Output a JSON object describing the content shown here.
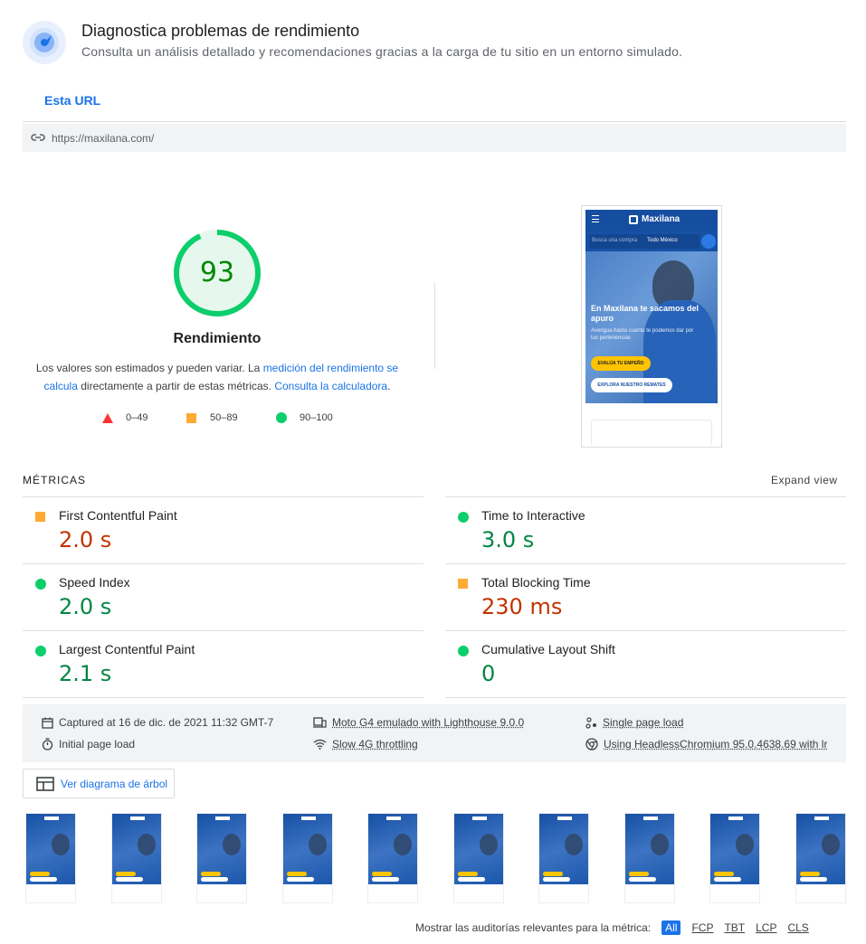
{
  "header": {
    "icon": "pagespeed-gauge-icon",
    "title": "Diagnostica problemas de rendimiento",
    "subtitle": "Consulta un análisis detallado y recomendaciones gracias a la carga de tu sitio en un entorno simulado."
  },
  "tabs": [
    {
      "label": "Esta URL",
      "active": true
    }
  ],
  "url_bar": {
    "icon": "link-icon",
    "url": "https://maxilana.com/"
  },
  "score": {
    "value": "93",
    "fraction": 0.93,
    "label": "Rendimiento",
    "color": "#0cce6b",
    "desc_prefix": "Los valores son estimados y pueden variar. La ",
    "desc_link1": "medición del rendimiento se calcula",
    "desc_middle": " directamente a partir de estas métricas. ",
    "desc_link2": "Consulta la calculadora",
    "desc_suffix": "."
  },
  "legend": [
    {
      "icon": "red-triangle-icon",
      "range": "0–49",
      "color": "#ff3333"
    },
    {
      "icon": "orange-square-icon",
      "range": "50–89",
      "color": "#ffaa33"
    },
    {
      "icon": "green-circle-icon",
      "range": "90–100",
      "color": "#0cce6b"
    }
  ],
  "screenshot": {
    "logo": "Maxilana",
    "search_placeholder": "Busca una compra",
    "location": "Todo México",
    "headline": "En Maxilana te sacamos del apuro",
    "subline": "Averigua hasta cuánto te podemos dar por tus pertenencias",
    "btn_primary": "EVALÚA TU EMPEÑO",
    "btn_secondary": "EXPLORA NUESTRO REMATES"
  },
  "metrics": {
    "title": "MÉTRICAS",
    "expand": "Expand view",
    "items": [
      {
        "name": "First Contentful Paint",
        "value": "2.0 s",
        "status": "average"
      },
      {
        "name": "Time to Interactive",
        "value": "3.0 s",
        "status": "pass"
      },
      {
        "name": "Speed Index",
        "value": "2.0 s",
        "status": "pass"
      },
      {
        "name": "Total Blocking Time",
        "value": "230 ms",
        "status": "average"
      },
      {
        "name": "Largest Contentful Paint",
        "value": "2.1 s",
        "status": "pass"
      },
      {
        "name": "Cumulative Layout Shift",
        "value": "0",
        "status": "pass"
      }
    ]
  },
  "info": {
    "captured": "Captured at 16 de dic. de 2021 11:32 GMT-7",
    "device": "Moto G4 emulado with Lighthouse 9.0.0",
    "session": "Single page load",
    "load": "Initial page load",
    "throttling": "Slow 4G throttling",
    "browser": "Using HeadlessChromium 95.0.4638.69 with lr"
  },
  "tree_button": {
    "icon": "treemap-icon",
    "label": "Ver diagrama de árbol"
  },
  "filmstrip_count": 10,
  "audit_filter": {
    "label": "Mostrar las auditorías relevantes para la métrica:",
    "options": [
      "All",
      "FCP",
      "TBT",
      "LCP",
      "CLS"
    ],
    "active": "All"
  }
}
